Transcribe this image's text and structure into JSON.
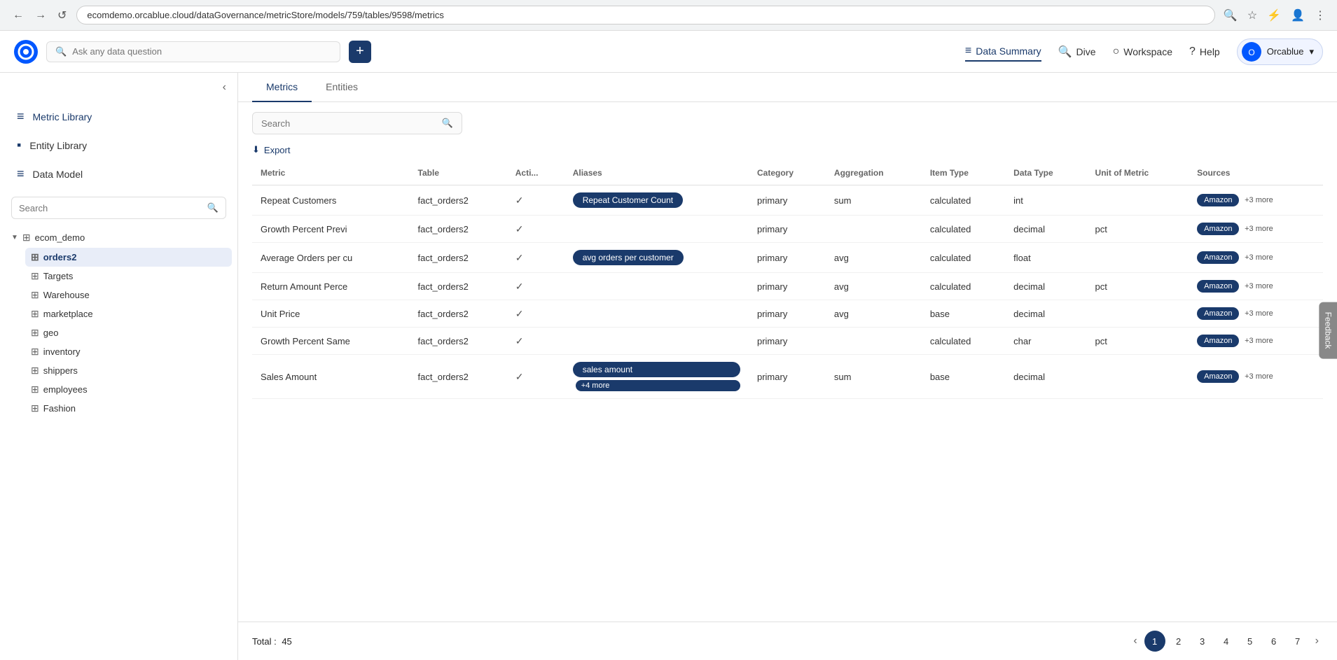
{
  "browser": {
    "back": "←",
    "forward": "→",
    "reload": "↺",
    "url": "ecomdemo.orcablue.cloud/dataGovernance/metricStore/models/759/tables/9598/metrics",
    "search_icon": "🔍",
    "star_icon": "☆",
    "menu_icon": "⋮"
  },
  "header": {
    "search_placeholder": "Ask any data question",
    "add_label": "+",
    "nav": [
      {
        "id": "data-summary",
        "label": "Data Summary",
        "icon": "≡",
        "active": true
      },
      {
        "id": "dive",
        "label": "Dive",
        "icon": "🔍"
      },
      {
        "id": "workspace",
        "label": "Workspace",
        "icon": "○"
      },
      {
        "id": "help",
        "label": "Help",
        "icon": "?"
      }
    ],
    "user_label": "Orcablue",
    "user_dropdown": "▾"
  },
  "sidebar": {
    "collapse_icon": "‹",
    "nav_items": [
      {
        "id": "metric-library",
        "label": "Metric Library",
        "icon": "≡",
        "active": true
      },
      {
        "id": "entity-library",
        "label": "Entity Library",
        "icon": "▪"
      },
      {
        "id": "data-model",
        "label": "Data Model",
        "icon": "≡"
      }
    ],
    "search_placeholder": "Search",
    "tree": {
      "root": {
        "label": "ecom_demo",
        "expanded": true,
        "children": [
          {
            "id": "orders2",
            "label": "orders2",
            "active": true
          },
          {
            "id": "targets",
            "label": "Targets"
          },
          {
            "id": "warehouse",
            "label": "Warehouse"
          },
          {
            "id": "marketplace",
            "label": "marketplace"
          },
          {
            "id": "geo",
            "label": "geo"
          },
          {
            "id": "inventory",
            "label": "inventory"
          },
          {
            "id": "shippers",
            "label": "shippers"
          },
          {
            "id": "employees",
            "label": "employees"
          },
          {
            "id": "fashion",
            "label": "Fashion"
          }
        ]
      }
    }
  },
  "tabs": [
    {
      "id": "metrics",
      "label": "Metrics",
      "active": true
    },
    {
      "id": "entities",
      "label": "Entities"
    }
  ],
  "table_search_placeholder": "Search",
  "export_label": "Export",
  "columns": [
    "Metric",
    "Table",
    "Acti...",
    "Aliases",
    "Category",
    "Aggregation",
    "Item Type",
    "Data Type",
    "Unit of Metric",
    "Sources"
  ],
  "rows": [
    {
      "metric": "Repeat Customers",
      "table": "fact_orders2",
      "active": true,
      "aliases": [
        {
          "label": "Repeat Customer Count",
          "style": "primary"
        }
      ],
      "category": "primary",
      "aggregation": "sum",
      "item_type": "calculated",
      "data_type": "int",
      "unit": "",
      "source": "Amazon",
      "more": "+3 more"
    },
    {
      "metric": "Growth Percent Previ",
      "table": "fact_orders2",
      "active": true,
      "aliases": [],
      "category": "primary",
      "aggregation": "",
      "item_type": "calculated",
      "data_type": "decimal",
      "unit": "pct",
      "source": "Amazon",
      "more": "+3 more"
    },
    {
      "metric": "Average Orders per cu",
      "table": "fact_orders2",
      "active": true,
      "aliases": [
        {
          "label": "avg orders per customer",
          "style": "secondary"
        }
      ],
      "category": "primary",
      "aggregation": "avg",
      "item_type": "calculated",
      "data_type": "float",
      "unit": "",
      "source": "Amazon",
      "more": "+3 more"
    },
    {
      "metric": "Return Amount Perce",
      "table": "fact_orders2",
      "active": true,
      "aliases": [],
      "category": "primary",
      "aggregation": "avg",
      "item_type": "calculated",
      "data_type": "decimal",
      "unit": "pct",
      "source": "Amazon",
      "more": "+3 more"
    },
    {
      "metric": "Unit Price",
      "table": "fact_orders2",
      "active": true,
      "aliases": [],
      "category": "primary",
      "aggregation": "avg",
      "item_type": "base",
      "data_type": "decimal",
      "unit": "",
      "source": "Amazon",
      "more": "+3 more"
    },
    {
      "metric": "Growth Percent Same",
      "table": "fact_orders2",
      "active": true,
      "aliases": [],
      "category": "primary",
      "aggregation": "",
      "item_type": "calculated",
      "data_type": "char",
      "unit": "pct",
      "source": "Amazon",
      "more": "+3 more"
    },
    {
      "metric": "Sales Amount",
      "table": "fact_orders2",
      "active": true,
      "aliases": [
        {
          "label": "sales amount",
          "style": "secondary"
        }
      ],
      "aliases_more": "+4 more",
      "category": "primary",
      "aggregation": "sum",
      "item_type": "base",
      "data_type": "decimal",
      "unit": "",
      "source": "Amazon",
      "more": "+3 more"
    }
  ],
  "footer": {
    "total_label": "Total :",
    "total_count": "45",
    "pages": [
      "1",
      "2",
      "3",
      "4",
      "5",
      "6",
      "7"
    ],
    "current_page": "1",
    "prev_icon": "‹",
    "next_icon": "›"
  },
  "feedback_label": "Feedback"
}
